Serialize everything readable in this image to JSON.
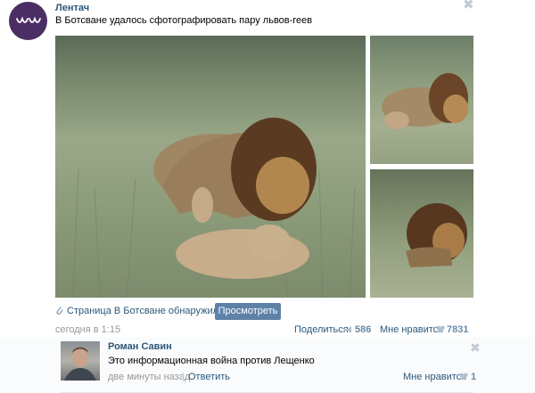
{
  "post": {
    "group_name": "Лентач",
    "text": "В Ботсване удалось сфотографировать пару львов-геев",
    "close_symbol": "✖",
    "link_text": "Страница В Ботсване обнаружили..",
    "view_button": "Просмотреть",
    "time": "сегодня в 1:15",
    "share_label": "Поделиться",
    "share_count": "586",
    "like_label": "Мне нравится",
    "like_count": "7831"
  },
  "comment": {
    "author": "Роман Савин",
    "text": "Это информационная война против Лещенко",
    "time": "две минуты назад",
    "separator": "|",
    "reply": "Ответить",
    "close_symbol": "✖",
    "like_label": "Мне нравится",
    "like_count": "1"
  },
  "icons": {
    "group_logo": "lentach-logo-icon",
    "link": "paperclip-icon",
    "share": "megaphone-icon",
    "like": "heart-icon",
    "close": "close-icon"
  },
  "colors": {
    "link_blue": "#2b587a",
    "button_blue": "#5e81a8",
    "count_blue": "#6a8aa8",
    "muted_gray": "#999999",
    "logo_purple": "#4b2e63"
  }
}
